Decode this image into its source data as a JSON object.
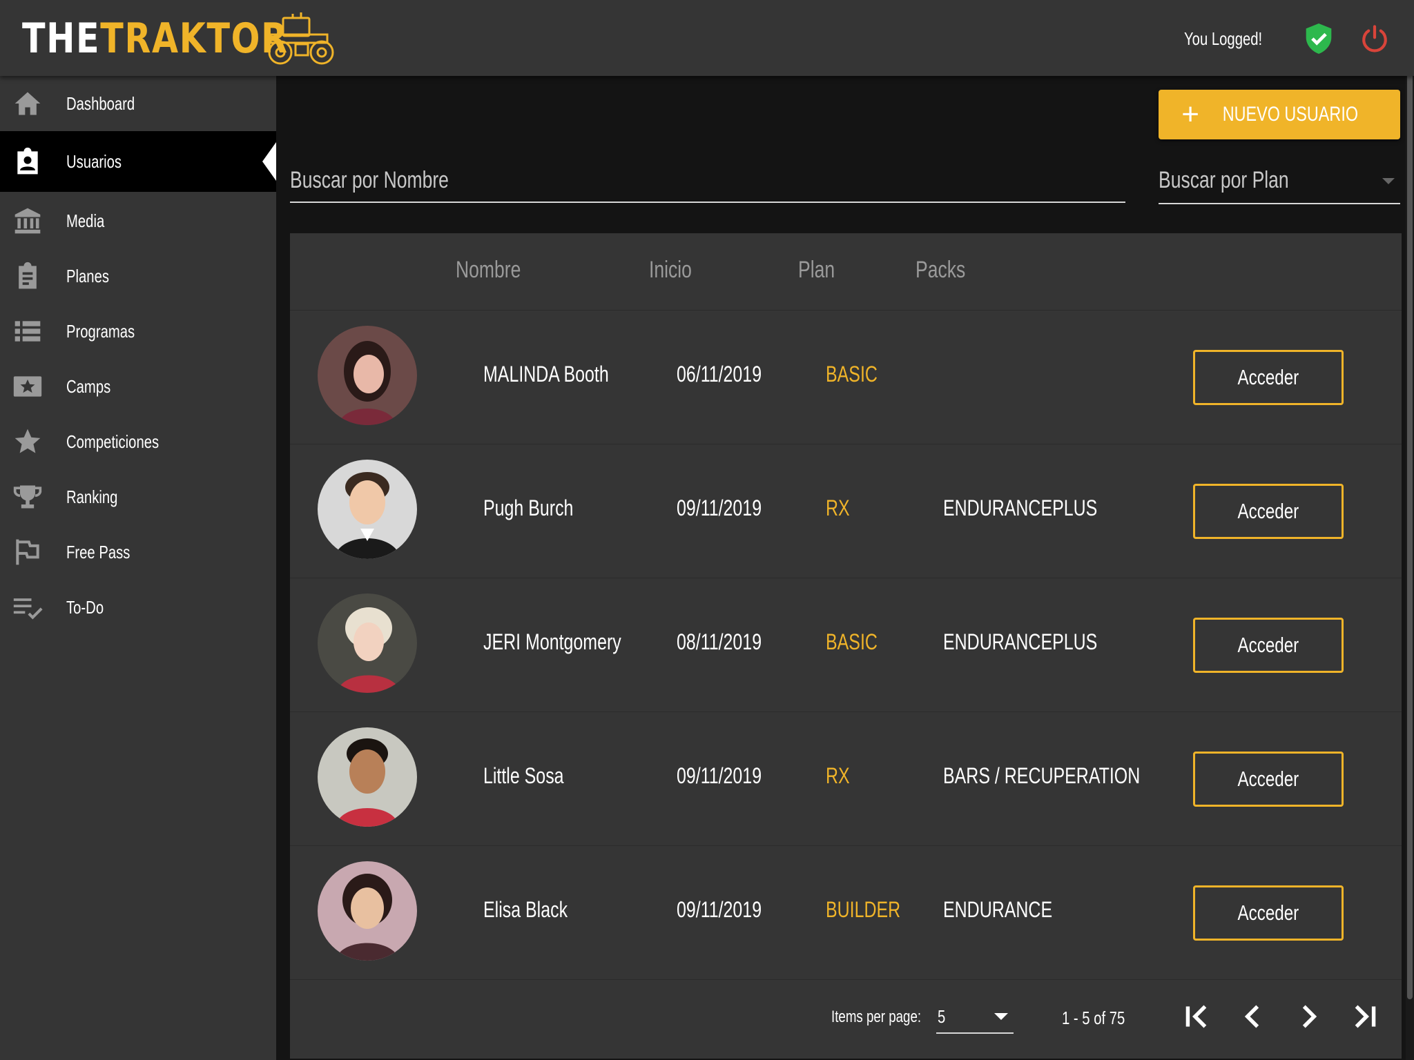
{
  "header": {
    "logo_the": "THE",
    "logo_traktor": "TRAKTOR",
    "logged_text": "You Logged!",
    "status_icon": "shield-check-icon",
    "logout_icon": "power-icon",
    "colors": {
      "accent": "#f0b429",
      "shield": "#2db84d",
      "power": "#d9443a"
    }
  },
  "sidebar": {
    "items": [
      {
        "label": "Dashboard",
        "icon": "home-icon"
      },
      {
        "label": "Usuarios",
        "icon": "badge-icon",
        "active": true
      },
      {
        "label": "Media",
        "icon": "bank-icon"
      },
      {
        "label": "Planes",
        "icon": "clipboard-icon"
      },
      {
        "label": "Programas",
        "icon": "list-icon"
      },
      {
        "label": "Camps",
        "icon": "star-box-icon"
      },
      {
        "label": "Competiciones",
        "icon": "star-icon"
      },
      {
        "label": "Ranking",
        "icon": "trophy-icon"
      },
      {
        "label": "Free Pass",
        "icon": "flag-icon"
      },
      {
        "label": "To-Do",
        "icon": "checklist-icon"
      }
    ]
  },
  "toolbar": {
    "new_user_label": "NUEVO USUARIO"
  },
  "search": {
    "name_placeholder": "Buscar por Nombre",
    "plan_placeholder": "Buscar por Plan"
  },
  "table": {
    "columns": [
      "Nombre",
      "Inicio",
      "Plan",
      "Packs"
    ],
    "rows": [
      {
        "name": "MALINDA Booth",
        "start": "06/11/2019",
        "plan": "BASIC",
        "packs": "",
        "action": "Acceder"
      },
      {
        "name": "Pugh Burch",
        "start": "09/11/2019",
        "plan": "RX",
        "packs": "ENDURANCEPLUS",
        "action": "Acceder"
      },
      {
        "name": "JERI Montgomery",
        "start": "08/11/2019",
        "plan": "BASIC",
        "packs": "ENDURANCEPLUS",
        "action": "Acceder"
      },
      {
        "name": "Little Sosa",
        "start": "09/11/2019",
        "plan": "RX",
        "packs": "BARS / RECUPERATION",
        "action": "Acceder"
      },
      {
        "name": "Elisa Black",
        "start": "09/11/2019",
        "plan": "BUILDER",
        "packs": "ENDURANCE",
        "action": "Acceder"
      }
    ]
  },
  "paginator": {
    "items_per_page_label": "Items per page:",
    "items_per_page_value": "5",
    "range_label": "1 - 5 of 75"
  }
}
